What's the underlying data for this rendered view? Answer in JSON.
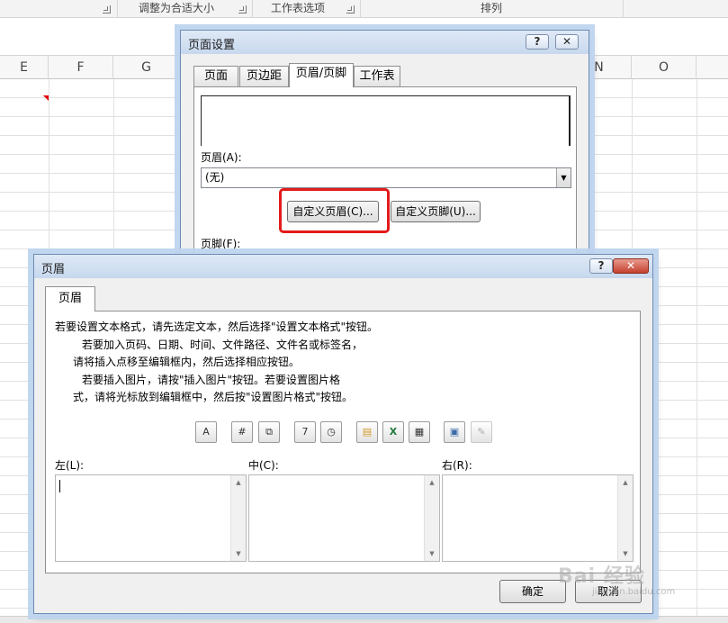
{
  "ribbon": {
    "groups": [
      "调整为合适大小",
      "工作表选项",
      "排列"
    ]
  },
  "sheet": {
    "columns": [
      {
        "id": "E",
        "label": "E"
      },
      {
        "id": "F",
        "label": "F"
      },
      {
        "id": "G",
        "label": "G"
      },
      {
        "id": "N",
        "label": "N"
      },
      {
        "id": "O",
        "label": "O"
      }
    ]
  },
  "page_setup": {
    "title": "页面设置",
    "help": "?",
    "close": "✕",
    "tabs": [
      "页面",
      "页边距",
      "页眉/页脚",
      "工作表"
    ],
    "active_tab": "页眉/页脚",
    "header_label": "页眉(A):",
    "header_value": "(无)",
    "custom_header_button": "自定义页眉(C)...",
    "custom_footer_button": "自定义页脚(U)...",
    "footer_label": "页脚(F):",
    "highlight_color": "#e31b1b"
  },
  "header_dialog": {
    "title": "页眉",
    "help": "?",
    "close": "✕",
    "tab": "页眉",
    "instructions": [
      "若要设置文本格式，请先选定文本，然后选择\"设置文本格式\"按钮。",
      "若要加入页码、日期、时间、文件路径、文件名或标签名，",
      "请将插入点移至编辑框内，然后选择相应按钮。",
      "若要插入图片，请按\"插入图片\"按钮。若要设置图片格",
      "式，请将光标放到编辑框中，然后按\"设置图片格式\"按钮。"
    ],
    "toolbar": [
      {
        "icon": "format-text-icon",
        "glyph": "A"
      },
      {
        "icon": "insert-page-number-icon",
        "glyph": "#"
      },
      {
        "icon": "insert-page-count-icon",
        "glyph": "⧉"
      },
      {
        "icon": "insert-date-icon",
        "glyph": "7"
      },
      {
        "icon": "insert-time-icon",
        "glyph": "◷"
      },
      {
        "icon": "insert-file-path-icon",
        "glyph": "▤"
      },
      {
        "icon": "insert-file-name-icon",
        "glyph": "X"
      },
      {
        "icon": "insert-sheet-name-icon",
        "glyph": "▦"
      },
      {
        "icon": "insert-picture-icon",
        "glyph": "▣"
      },
      {
        "icon": "format-picture-icon",
        "glyph": "✎"
      }
    ],
    "sections": {
      "left": "左(L):",
      "center": "中(C):",
      "right": "右(R):"
    },
    "ok_button": "确定",
    "cancel_button": "取消"
  },
  "watermark": {
    "brand": "Bai 经验",
    "url": "jingyan.baidu.com"
  }
}
